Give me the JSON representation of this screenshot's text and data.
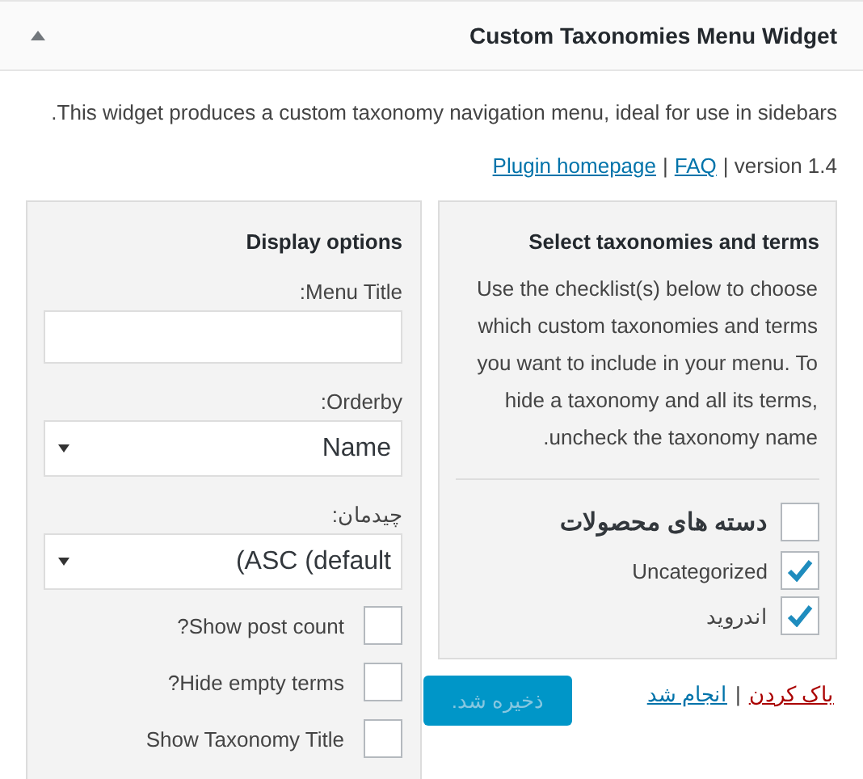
{
  "widget": {
    "title": "Custom Taxonomies Menu Widget",
    "expanded": true,
    "description": "This widget produces a custom taxonomy navigation menu, ideal for use in sidebars.",
    "meta": [
      {
        "kind": "link",
        "text": "Plugin homepage"
      },
      {
        "kind": "text",
        "text": "|"
      },
      {
        "kind": "link",
        "text": "FAQ"
      },
      {
        "kind": "text",
        "text": "| version 1.4"
      }
    ]
  },
  "display_options": {
    "title": "Display options",
    "menu_title": {
      "label": "Menu Title:"
    },
    "orderby": {
      "label": "Orderby:",
      "value": "Name"
    },
    "order": {
      "label": "چیدمان:",
      "value": "(ASC (default"
    },
    "options": [
      {
        "label": "Show post count?",
        "checked": false
      },
      {
        "label": "Hide empty terms?",
        "checked": false
      },
      {
        "label": "Show Taxonomy Title",
        "checked": false
      }
    ]
  },
  "taxonomies": {
    "title": "Select taxonomies and terms",
    "help": "Use the checklist(s) below to choose which custom taxonomies and terms you want to include in your menu. To hide a taxonomy and all its terms, uncheck the taxonomy name.",
    "items": [
      {
        "label": "دسته های محصولات",
        "checked": false,
        "children": [
          {
            "label": "Uncategorized",
            "checked": true
          },
          {
            "label": "اندروید",
            "checked": true
          }
        ]
      }
    ]
  },
  "actions": {
    "links": [
      {
        "kind": "danger-link",
        "text": "باک کردن"
      },
      {
        "kind": "text",
        "text": "|"
      },
      {
        "kind": "link",
        "text": "انجام شد"
      }
    ],
    "save": {
      "label": "ذخیره شد.",
      "disabled": true
    }
  }
}
